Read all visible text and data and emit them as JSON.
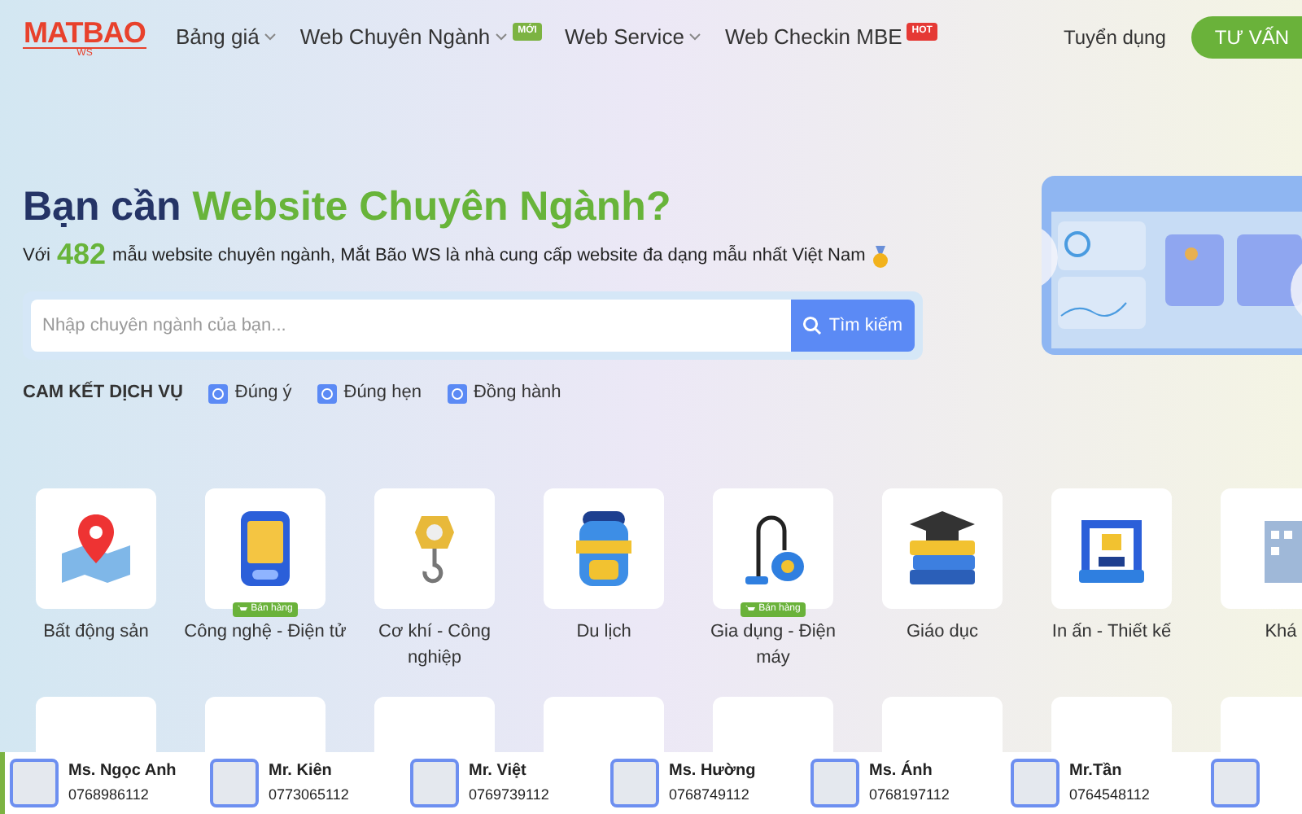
{
  "logo": {
    "text": "MATBAO",
    "sub": "WS"
  },
  "nav": [
    {
      "label": "Bảng giá",
      "has_menu": true
    },
    {
      "label": "Web Chuyên Ngành",
      "has_menu": true,
      "badge": {
        "text": "MỚI",
        "color": "#7cb342"
      }
    },
    {
      "label": "Web Service",
      "has_menu": true
    },
    {
      "label": "Web Checkin MBE",
      "has_menu": false,
      "badge": {
        "text": "HOT",
        "color": "#e53935"
      }
    }
  ],
  "header_link": "Tuyển dụng",
  "cta_button": "TƯ VẤN",
  "hero": {
    "title_lead": "Bạn cần",
    "title_highlight": "Website Chuyên Ngành?",
    "subtitle_lead": "Với",
    "count": "482",
    "subtitle_rest": "mẫu website chuyên ngành, Mắt Bão WS là nhà cung cấp website đa dạng mẫu nhất Việt Nam"
  },
  "search": {
    "placeholder": "Nhập chuyên ngành của bạn...",
    "button": "Tìm kiếm"
  },
  "commitments": {
    "label": "CAM KẾT DỊCH VỤ",
    "items": [
      "Đúng ý",
      "Đúng hẹn",
      "Đồng hành"
    ]
  },
  "categories": [
    {
      "label": "Bất động sản"
    },
    {
      "label": "Công nghệ - Điện tử",
      "badge": "Bán hàng"
    },
    {
      "label": "Cơ khí - Công nghiệp"
    },
    {
      "label": "Du lịch"
    },
    {
      "label": "Gia dụng - Điện máy",
      "badge": "Bán hàng"
    },
    {
      "label": "Giáo dục"
    },
    {
      "label": "In ấn - Thiết kế"
    },
    {
      "label": "Khá"
    }
  ],
  "contacts": [
    {
      "name": "Ms. Ngọc Anh",
      "phone": "0768986112"
    },
    {
      "name": "Mr. Kiên",
      "phone": "0773065112"
    },
    {
      "name": "Mr. Việt",
      "phone": "0769739112"
    },
    {
      "name": "Ms. Hường",
      "phone": "0768749112"
    },
    {
      "name": "Ms. Ánh",
      "phone": "0768197112"
    },
    {
      "name": "Mr.Tần",
      "phone": "0764548112"
    }
  ],
  "more_contacts": true
}
